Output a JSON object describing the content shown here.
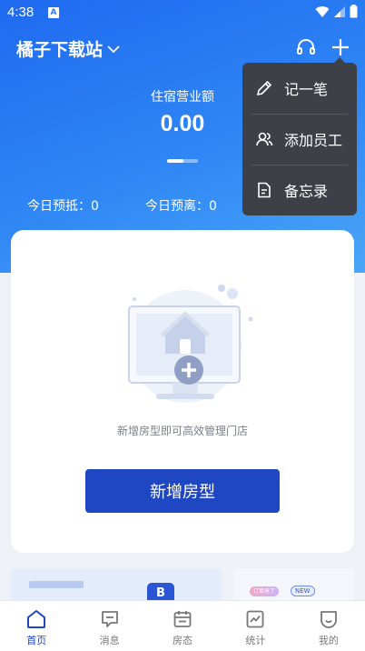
{
  "status_bar": {
    "time": "4:38",
    "notification_letter": "A"
  },
  "header": {
    "store_name": "橘子下载站"
  },
  "hero": {
    "revenue_label": "住宿营业额",
    "revenue_value": "0.00",
    "today_checkin_label": "今日预抵：",
    "today_checkin_value": "0",
    "today_checkout_label": "今日预离：",
    "today_checkout_value": "0"
  },
  "popup_menu": {
    "items": [
      {
        "label": "记一笔",
        "icon": "pencil-icon"
      },
      {
        "label": "添加员工",
        "icon": "users-icon"
      },
      {
        "label": "备忘录",
        "icon": "document-icon"
      }
    ]
  },
  "empty_state": {
    "message": "新增房型即可高效管理门店",
    "button_label": "新增房型"
  },
  "banners": {
    "left_badge": "B",
    "right_tag": "订单来了",
    "right_new": "NEW"
  },
  "tabbar": {
    "active": "home",
    "tabs": [
      {
        "label": "首页",
        "icon": "home-icon"
      },
      {
        "label": "消息",
        "icon": "message-icon"
      },
      {
        "label": "房态",
        "icon": "calendar-icon"
      },
      {
        "label": "统计",
        "icon": "chart-icon"
      },
      {
        "label": "我的",
        "icon": "profile-icon"
      }
    ]
  },
  "colors": {
    "primary": "#1f46c3",
    "hero_gradient_start": "#1f6af0",
    "hero_gradient_end": "#4aa6f7",
    "popup_bg": "#3d4047"
  }
}
